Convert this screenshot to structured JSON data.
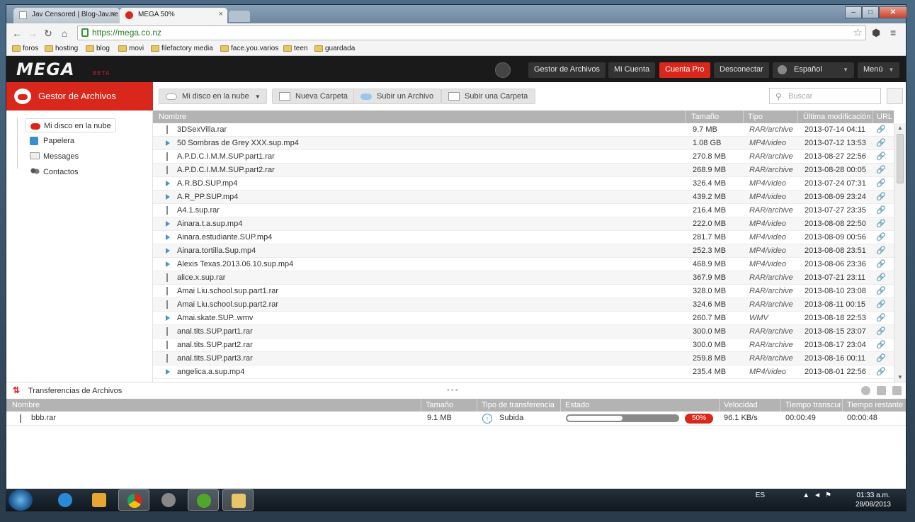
{
  "browser": {
    "tabs": [
      {
        "title": "Jav Censored | Blog-Jav.ne",
        "close": "×"
      },
      {
        "title": "MEGA 50%",
        "close": "×"
      }
    ],
    "window_controls": {
      "minimize": "–",
      "maximize": "□",
      "close": "✕"
    },
    "nav": {
      "back": "←",
      "forward": "→",
      "reload": "↻",
      "home": "⌂"
    },
    "url": "https://mega.co.nz",
    "bookmarks": [
      "foros",
      "hosting",
      "blog",
      "movi",
      "filefactory media",
      "face.you.varios",
      "teen",
      "guardada"
    ]
  },
  "header": {
    "logo": "MEGA",
    "beta": "BETA",
    "buttons": {
      "gestor": "Gestor de Archivos",
      "cuenta": "Mi Cuenta",
      "pro": "Cuenta Pro",
      "desconectar": "Desconectar",
      "idioma": "Español",
      "menu": "Menú"
    }
  },
  "sidebar": {
    "title": "Gestor de Archivos",
    "items": [
      {
        "label": "Mi disco en la nube",
        "icon": "cloud-icon"
      },
      {
        "label": "Papelera",
        "icon": "trash-icon"
      },
      {
        "label": "Messages",
        "icon": "envelope-icon"
      },
      {
        "label": "Contactos",
        "icon": "contacts-icon"
      }
    ]
  },
  "toolbar": {
    "cloud_drive": "Mi disco en la nube",
    "new_folder": "Nueva Carpeta",
    "upload_file": "Subir un Archivo",
    "upload_folder": "Subir una Carpeta",
    "search_placeholder": "Buscar"
  },
  "files": {
    "columns": {
      "name": "Nombre",
      "size": "Tamaño",
      "type": "Tipo",
      "modified": "Última modificación",
      "url": "URL"
    },
    "rows": [
      {
        "name": "3DSexVilla.rar",
        "size": "9.7 MB",
        "type": "RAR/archive",
        "date": "2013-07-14 04:11",
        "icon": "rar"
      },
      {
        "name": "50 Sombras de Grey XXX.sup.mp4",
        "size": "1.08 GB",
        "type": "MP4/video",
        "date": "2013-07-12 13:53",
        "icon": "vid"
      },
      {
        "name": "A.P.D.C.I.M.M.SUP.part1.rar",
        "size": "270.8 MB",
        "type": "RAR/archive",
        "date": "2013-08-27 22:56",
        "icon": "rar"
      },
      {
        "name": "A.P.D.C.I.M.M.SUP.part2.rar",
        "size": "268.9 MB",
        "type": "RAR/archive",
        "date": "2013-08-28 00:05",
        "icon": "rar"
      },
      {
        "name": "A.R.BD.SUP.mp4",
        "size": "326.4 MB",
        "type": "MP4/video",
        "date": "2013-07-24 07:31",
        "icon": "vid"
      },
      {
        "name": "A.R_PP.SUP.mp4",
        "size": "439.2 MB",
        "type": "MP4/video",
        "date": "2013-08-09 23:24",
        "icon": "vid"
      },
      {
        "name": "A4.1.sup.rar",
        "size": "216.4 MB",
        "type": "RAR/archive",
        "date": "2013-07-27 23:35",
        "icon": "rar"
      },
      {
        "name": "Ainara.t.a.sup.mp4",
        "size": "222.0 MB",
        "type": "MP4/video",
        "date": "2013-08-08 22:50",
        "icon": "vid"
      },
      {
        "name": "Ainara.estudiante.SUP.mp4",
        "size": "281.7 MB",
        "type": "MP4/video",
        "date": "2013-08-09 00:56",
        "icon": "vid"
      },
      {
        "name": "Ainara.tortilla.Sup.mp4",
        "size": "252.3 MB",
        "type": "MP4/video",
        "date": "2013-08-08 23:51",
        "icon": "vid"
      },
      {
        "name": "Alexis Texas.2013.06.10.sup.mp4",
        "size": "468.9 MB",
        "type": "MP4/video",
        "date": "2013-08-06 23:36",
        "icon": "vid"
      },
      {
        "name": "alice.x.sup.rar",
        "size": "367.9 MB",
        "type": "RAR/archive",
        "date": "2013-07-21 23:11",
        "icon": "rar"
      },
      {
        "name": "Amai Liu.school.sup.part1.rar",
        "size": "328.0 MB",
        "type": "RAR/archive",
        "date": "2013-08-10 23:08",
        "icon": "rar"
      },
      {
        "name": "Amai Liu.school.sup.part2.rar",
        "size": "324.6 MB",
        "type": "RAR/archive",
        "date": "2013-08-11 00:15",
        "icon": "rar"
      },
      {
        "name": "Amai.skate.SUP..wmv",
        "size": "260.7 MB",
        "type": "WMV",
        "date": "2013-08-18 22:53",
        "icon": "vid"
      },
      {
        "name": "anal.tits.SUP.part1.rar",
        "size": "300.0 MB",
        "type": "RAR/archive",
        "date": "2013-08-15 23:07",
        "icon": "rar"
      },
      {
        "name": "anal.tits.SUP.part2.rar",
        "size": "300.0 MB",
        "type": "RAR/archive",
        "date": "2013-08-17 23:04",
        "icon": "rar"
      },
      {
        "name": "anal.tits.SUP.part3.rar",
        "size": "259.8 MB",
        "type": "RAR/archive",
        "date": "2013-08-16 00:11",
        "icon": "rar"
      },
      {
        "name": "angelica.a.sup.mp4",
        "size": "235.4 MB",
        "type": "MP4/video",
        "date": "2013-08-01 22:56",
        "icon": "vid"
      }
    ]
  },
  "transfers": {
    "title": "Transferencias de Archivos",
    "columns": {
      "name": "Nombre",
      "size": "Tamaño",
      "kind": "Tipo de transferencia",
      "status": "Estado",
      "speed": "Velocidad",
      "elapsed": "Tiempo transcurr",
      "remaining": "Tiempo restante"
    },
    "row": {
      "name": "bbb.rar",
      "size": "9.1 MB",
      "kind": "Subida",
      "progress": 0.5,
      "percent": "50%",
      "speed": "96.1 KB/s",
      "elapsed": "00:00:49",
      "remaining": "00:00:48"
    }
  },
  "taskbar": {
    "lang": "ES",
    "time": "01:33 a.m.",
    "date": "28/08/2013"
  },
  "colors": {
    "accent": "#d9271c",
    "header": "#1a1a1a"
  }
}
